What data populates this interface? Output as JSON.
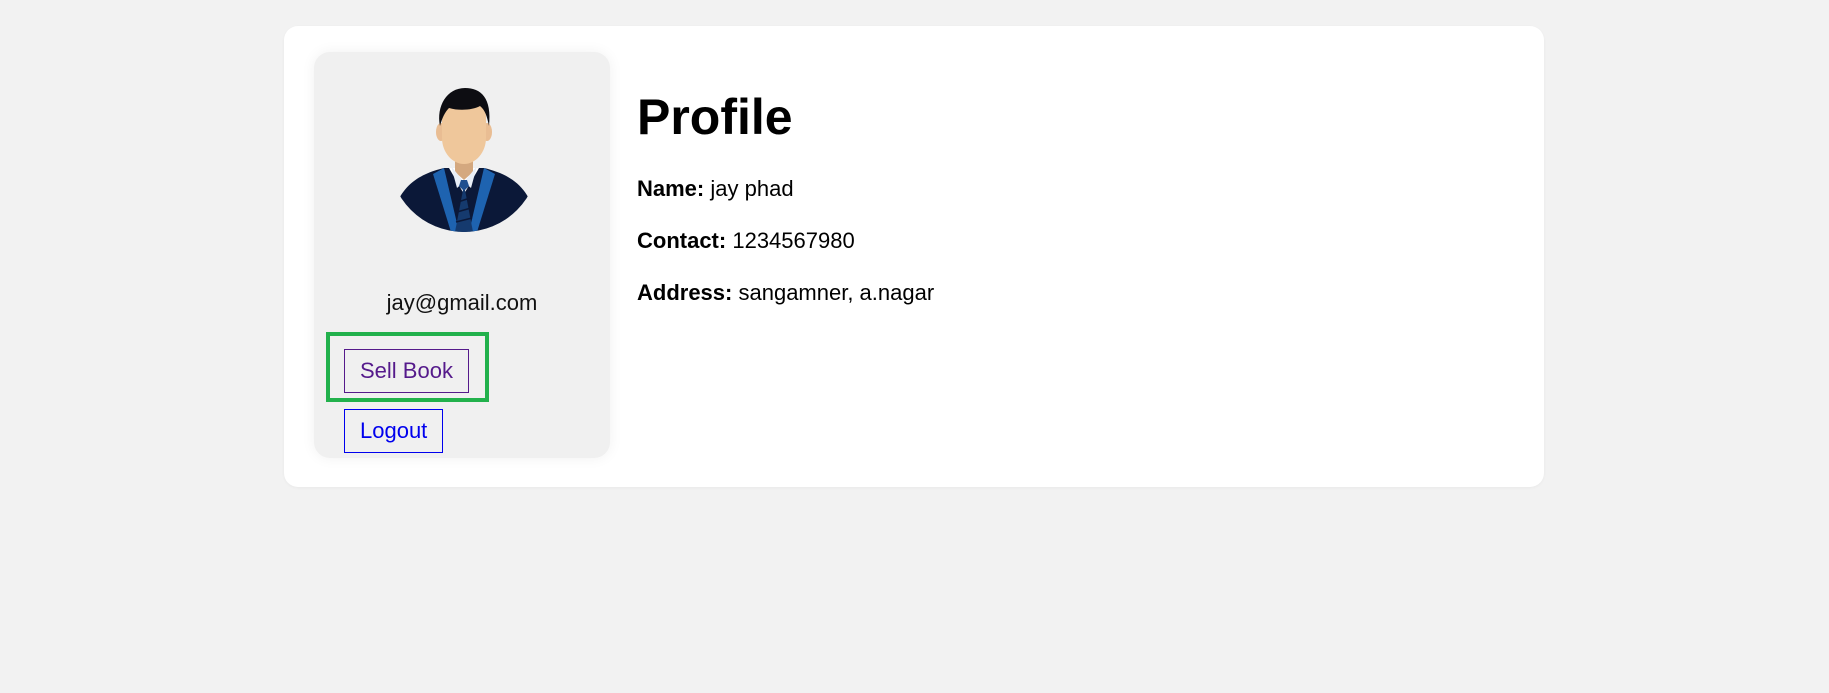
{
  "sidebar": {
    "avatar_icon": "user-avatar-businessman",
    "email": "jay@gmail.com",
    "sell_book_label": "Sell Book",
    "logout_label": "Logout"
  },
  "profile": {
    "title": "Profile",
    "fields": [
      {
        "label": "Name:",
        "value": "jay phad"
      },
      {
        "label": "Contact:",
        "value": "1234567980"
      },
      {
        "label": "Address:",
        "value": "sangamner, a.nagar"
      }
    ]
  },
  "colors": {
    "page_background": "#f2f2f2",
    "card_background": "#ffffff",
    "sidebar_background": "#f0f0f0",
    "highlight_border": "#22b14c",
    "visited_link": "#551a8b",
    "link": "#0000ee"
  }
}
